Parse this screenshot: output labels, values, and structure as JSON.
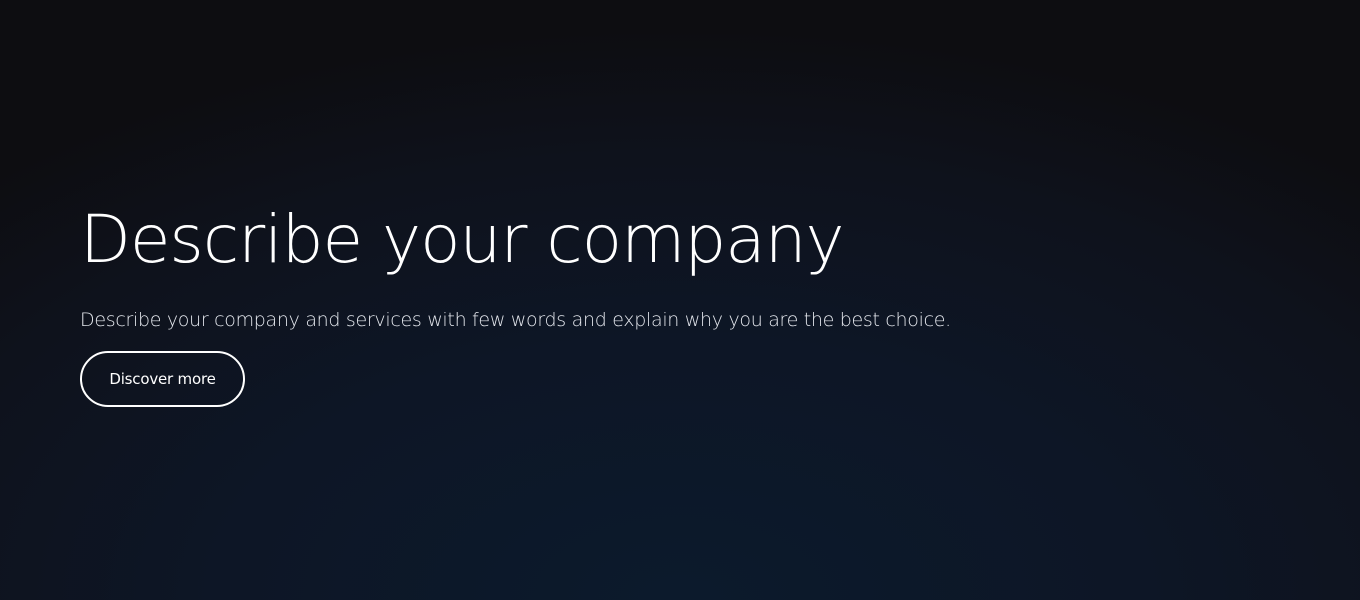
{
  "hero": {
    "title": "Describe your company",
    "subtitle": "Describe your company and services with few words and explain why you are the best choice.",
    "cta_label": "Discover more"
  },
  "colors": {
    "background_top": "#0f131b",
    "background_bottom_center": "#0c1a2c",
    "text": "#ffffff",
    "button_border": "#ffffff"
  }
}
